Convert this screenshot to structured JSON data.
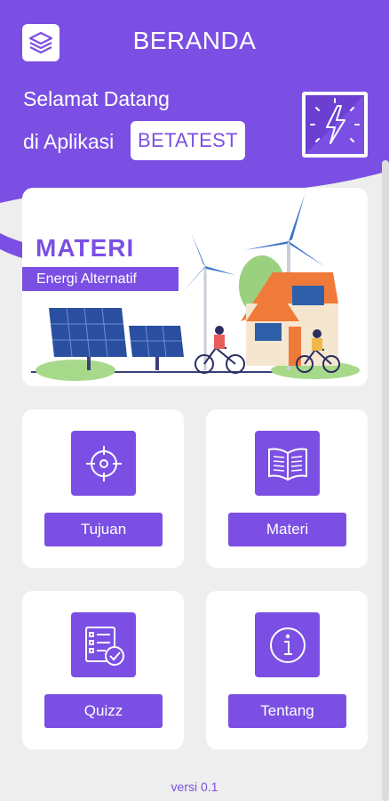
{
  "header": {
    "title": "BERANDA",
    "welcome_line1": "Selamat Datang",
    "welcome_line2": "di Aplikasi",
    "app_name": "BETATEST",
    "menu_icon": "layers-icon",
    "logo_icon": "lightning-bolt-icon"
  },
  "banner": {
    "title": "MATERI",
    "subtitle": "Energi Alternatif"
  },
  "menu": [
    {
      "label": "Tujuan",
      "icon": "target-icon"
    },
    {
      "label": "Materi",
      "icon": "book-icon"
    },
    {
      "label": "Quizz",
      "icon": "checklist-icon"
    },
    {
      "label": "Tentang",
      "icon": "info-icon"
    }
  ],
  "footer": {
    "version": "versi 0.1"
  },
  "colors": {
    "accent": "#7b4fe3",
    "background": "#eeeeee"
  }
}
